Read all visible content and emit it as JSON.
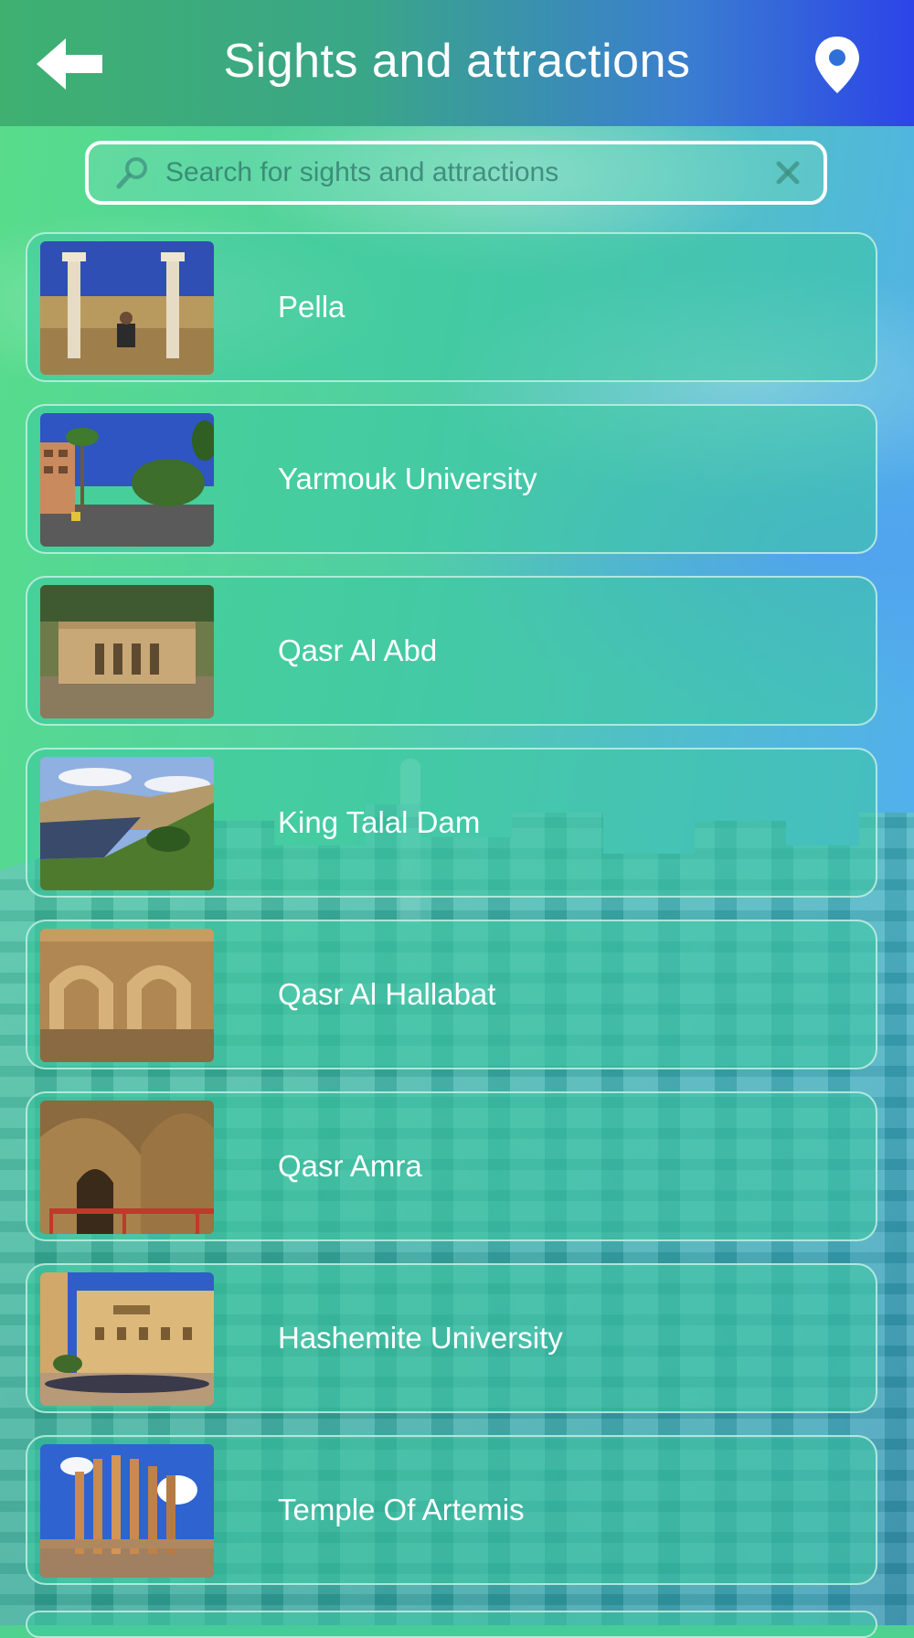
{
  "header": {
    "title": "Sights and attractions",
    "back_icon": "arrow-left-icon",
    "location_icon": "map-pin-icon",
    "colors": {
      "left": "#3fb070",
      "right": "#2c44e8"
    }
  },
  "search": {
    "placeholder": "Search for sights and attractions",
    "value": ""
  },
  "list": {
    "items": [
      {
        "label": "Pella"
      },
      {
        "label": "Yarmouk University"
      },
      {
        "label": "Qasr Al Abd"
      },
      {
        "label": "King Talal Dam"
      },
      {
        "label": "Qasr Al Hallabat"
      },
      {
        "label": "Qasr Amra"
      },
      {
        "label": "Hashemite University"
      },
      {
        "label": "Temple Of Artemis"
      }
    ]
  }
}
